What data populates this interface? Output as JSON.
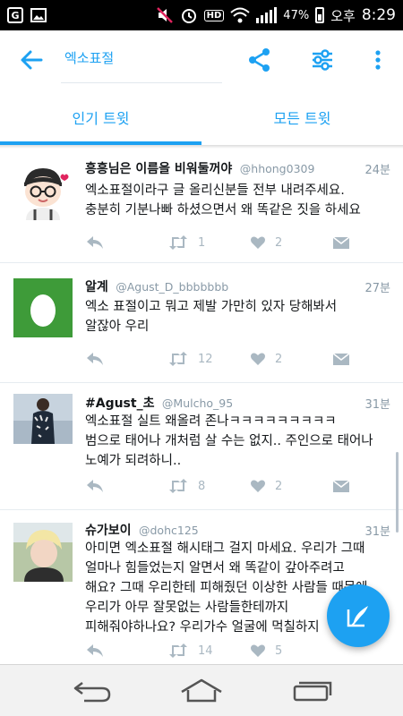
{
  "status_bar": {
    "battery": "47%",
    "ampm": "오후",
    "time": "8:29",
    "hd": "HD"
  },
  "header": {
    "search_term": "엑소표절",
    "back_icon": "arrow-left-icon",
    "actions": [
      "share-icon",
      "filter-icon",
      "more-vert-icon"
    ]
  },
  "tabs": [
    {
      "label": "인기 트윗",
      "active": true
    },
    {
      "label": "모든 트윗",
      "active": false
    }
  ],
  "tweets": [
    {
      "name": "흥흥님은 이름을 비워둘꺼야",
      "handle": "@hhong0309",
      "time": "24분",
      "text": "엑소표절이라구 글 올리신분들 전부 내려주세요.\n충분히 기분나빠 하셨으면서 왜 똑같은 짓을 하세요",
      "retweets": "1",
      "likes": "2"
    },
    {
      "name": "알계",
      "handle": "@Agust_D_bbbbbbb",
      "time": "27분",
      "text": "엑소 표절이고 뭐고 제발 가만히 있자 당해봐서\n알잖아 우리",
      "retweets": "12",
      "likes": "2"
    },
    {
      "name": "#Agust_초",
      "handle": "@Mulcho_95",
      "time": "31분",
      "text": "엑소표절 실트 왜올려 존나ㅋㅋㅋㅋㅋㅋㅋㅋㅋ\n범으로 태어나 개처럼 살 수는 없지.. 주인으로 태어나\n노예가 되려하니..",
      "retweets": "8",
      "likes": "2"
    },
    {
      "name": "슈가보이",
      "handle": "@dohc125",
      "time": "31분",
      "text": "아미면 엑소표절 해시태그 걸지 마세요. 우리가 그때\n얼마나 힘들었는지 알면서 왜 똑같이 갚아주려고\n해요? 그때 우리한테 피해줬던 이상한 사람들 때문에\n우리가 아무 잘못없는 사람들한테까지\n피해줘야하나요? 우리가수 얼굴에 먹칠하지",
      "retweets": "14",
      "likes": "5"
    }
  ],
  "colors": {
    "accent": "#1da1f2",
    "muted": "#aab8c2"
  }
}
